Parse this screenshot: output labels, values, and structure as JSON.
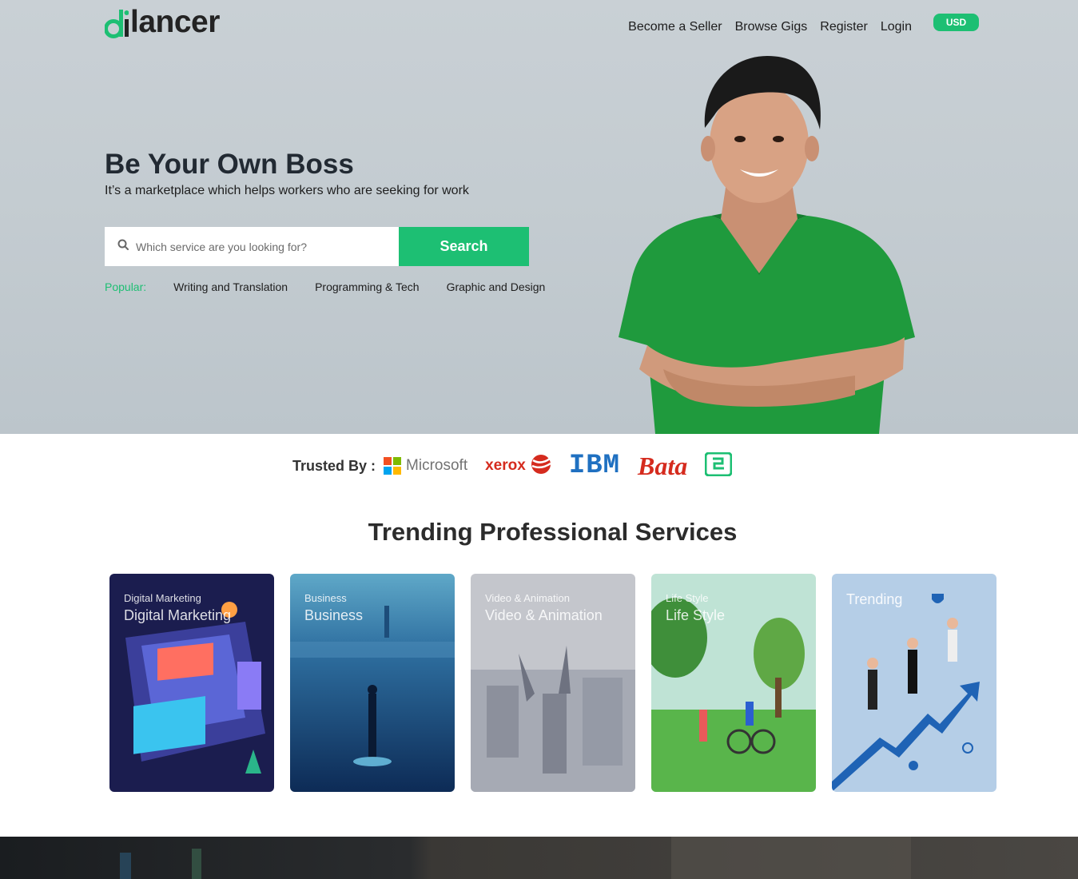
{
  "header": {
    "logo_text": "lancer",
    "nav": [
      {
        "label": "Become a Seller"
      },
      {
        "label": "Browse Gigs"
      },
      {
        "label": "Register"
      },
      {
        "label": "Login"
      }
    ],
    "currency": "USD"
  },
  "hero": {
    "title": "Be Your Own Boss",
    "subtitle": "It’s a marketplace which helps workers who are seeking for work",
    "search": {
      "placeholder": "Which service are you looking for?",
      "button_label": "Search"
    },
    "popular": {
      "label": "Popular:",
      "items": [
        "Writing and Translation",
        "Programming & Tech",
        "Graphic and Design"
      ]
    }
  },
  "trusted": {
    "label": "Trusted By :",
    "brands": [
      "Microsoft",
      "xerox",
      "IBM",
      "Bata"
    ]
  },
  "trending": {
    "title": "Trending Professional Services",
    "cards": [
      {
        "small": "Digital Marketing",
        "big": "Digital Marketing"
      },
      {
        "small": "Business",
        "big": "Business"
      },
      {
        "small": "Video & Animation",
        "big": "Video & Animation"
      },
      {
        "small": "Life Style",
        "big": "Life Style"
      },
      {
        "single": "Trending"
      }
    ]
  },
  "colors": {
    "accent": "#1dbf73",
    "text_dark": "#222a33"
  }
}
